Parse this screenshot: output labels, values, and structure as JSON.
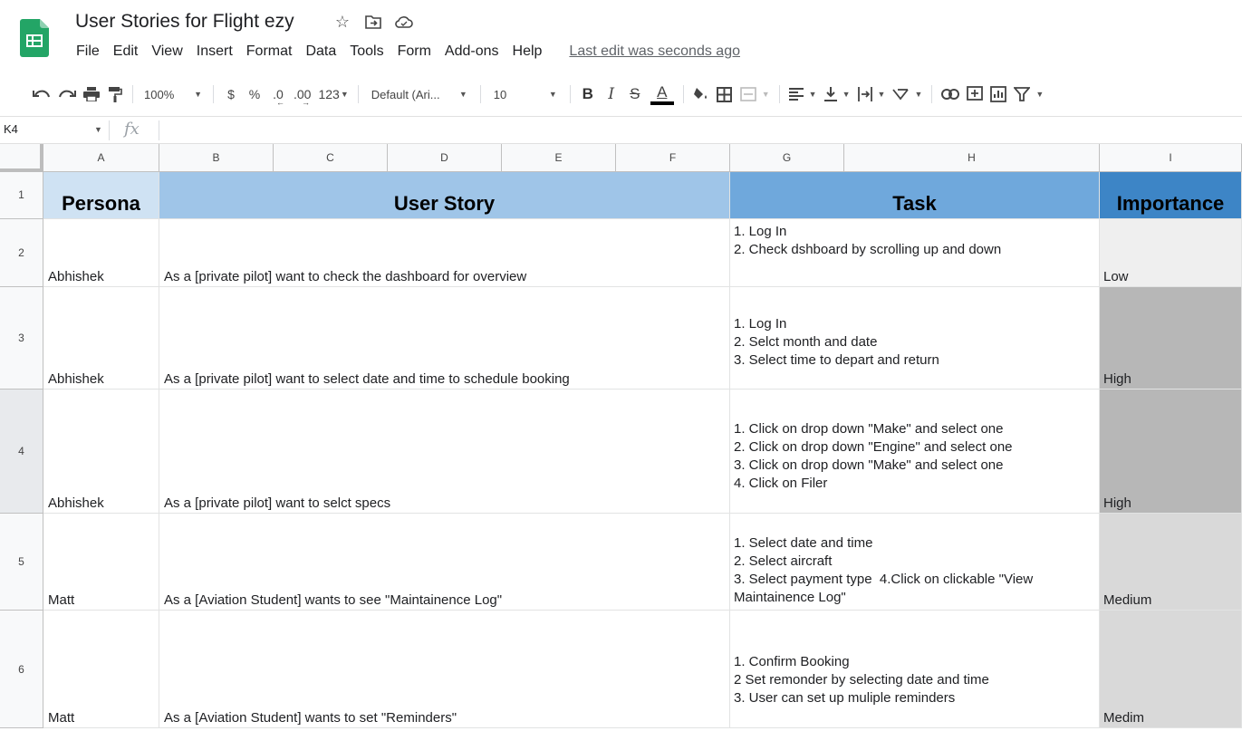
{
  "app": {
    "doc_title": "User Stories for Flight ezy",
    "last_edit": "Last edit was seconds ago"
  },
  "menu": [
    "File",
    "Edit",
    "View",
    "Insert",
    "Format",
    "Data",
    "Tools",
    "Form",
    "Add-ons",
    "Help"
  ],
  "toolbar": {
    "zoom": "100%",
    "currency": "$",
    "percent": "%",
    "decrease_decimal": ".0",
    "increase_decimal": ".00",
    "more_formats": "123",
    "font": "Default (Ari...",
    "font_size": "10",
    "bold": "B",
    "italic": "I",
    "strike": "S",
    "text_color": "A"
  },
  "formula_bar": {
    "cell_ref": "K4",
    "fx": "fx",
    "value": ""
  },
  "columns": [
    "A",
    "B",
    "C",
    "D",
    "E",
    "F",
    "G",
    "H",
    "I"
  ],
  "rows": [
    {
      "num": "1",
      "persona": "Persona",
      "story": "User Story",
      "task": "Task",
      "importance": "Importance"
    },
    {
      "num": "2",
      "persona": "Abhishek",
      "story": "As a [private pilot] want to check the dashboard for overview",
      "task": "1. Log In\n2. Check dshboard by scrolling up and down",
      "importance": "Low"
    },
    {
      "num": "3",
      "persona": "Abhishek",
      "story": "As a [private pilot] want to select date and time to schedule booking",
      "task": "1. Log In\n2. Selct month and date\n3. Select time to depart and return",
      "importance": "High"
    },
    {
      "num": "4",
      "persona": "Abhishek",
      "story": "As a [private pilot] want to selct specs",
      "task": "1. Click on drop down \"Make\" and select one\n2. Click on drop down \"Engine\" and select one\n3. Click on drop down \"Make\" and select one\n4. Click on Filer",
      "importance": "High"
    },
    {
      "num": "5",
      "persona": "Matt",
      "story": "As a [Aviation Student] wants to see \"Maintainence Log\"",
      "task": "1. Select date and time\n2. Select aircraft\n3. Select payment type  4.Click on clickable \"View Maintainence Log\"",
      "importance": "Medium"
    },
    {
      "num": "6",
      "persona": "Matt",
      "story": "As a [Aviation Student] wants to set \"Reminders\"",
      "task": "1. Confirm Booking\n2 Set remonder by selecting date and time\n3. User can set up muliple reminders",
      "importance": "Medim"
    }
  ],
  "colors": {
    "persona_header": "#cfe2f3",
    "story_header": "#9fc5e8",
    "task_header": "#6fa8dc",
    "importance_header": "#3d85c6",
    "importance_low": "#efefef",
    "importance_high": "#b7b7b7",
    "importance_medium": "#d9d9d9"
  }
}
